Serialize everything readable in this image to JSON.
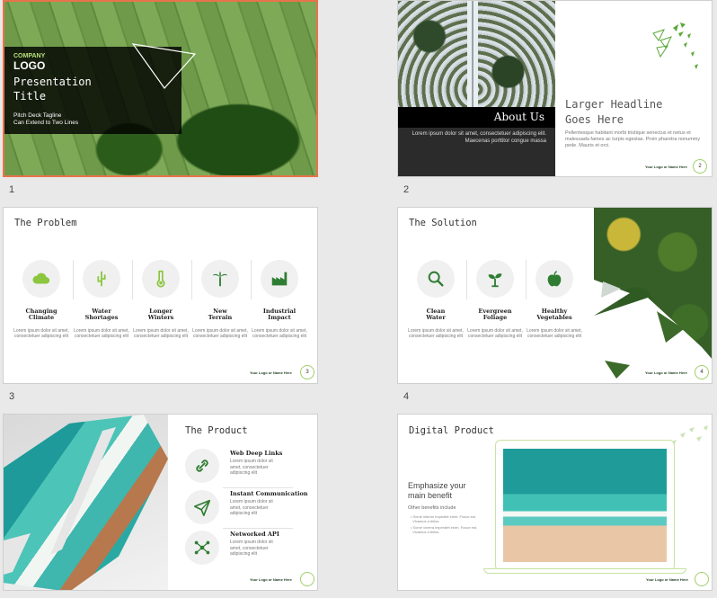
{
  "slides": [
    {
      "number": "1",
      "company": "COMPANY",
      "logo": "LOGO",
      "title_line1": "Presentation",
      "title_line2": "Title",
      "tagline_line1": "Pitch Deck Tagline",
      "tagline_line2": "Can Extend to Two Lines"
    },
    {
      "number": "2",
      "about": "About Us",
      "about_body": "Lorem ipsum dolor sit amet, consectetuer adipiscing elit. Maecenas porttitor congue massa",
      "headline_line1": "Larger Headline",
      "headline_line2": "Goes Here",
      "body": "Pellentesque habitant morbi tristique senectus et netus et malesuada fames ac turpis egestas. Proin pharetra nonummy pede. Mauris et orci.",
      "footer": "Your Logo or Name Here",
      "page": "2"
    },
    {
      "number": "3",
      "title": "The Problem",
      "items": [
        {
          "label1": "Changing",
          "label2": "Climate",
          "icon": "cloud-icon"
        },
        {
          "label1": "Water",
          "label2": "Shortages",
          "icon": "cactus-icon"
        },
        {
          "label1": "Longer",
          "label2": "Winters",
          "icon": "thermometer-icon"
        },
        {
          "label1": "New",
          "label2": "Terrain",
          "icon": "palm-tree-icon"
        },
        {
          "label1": "Industrial",
          "label2": "Impact",
          "icon": "factory-icon"
        }
      ],
      "item_body": "Lorem ipsum dolor sit amet, consectetuer adipiscing elit",
      "footer": "Your Logo or Name Here",
      "page": "3"
    },
    {
      "number": "4",
      "title": "The Solution",
      "items": [
        {
          "label1": "Clean",
          "label2": "Water",
          "icon": "magnifier-icon"
        },
        {
          "label1": "Evergreen",
          "label2": "Foliage",
          "icon": "sprout-icon"
        },
        {
          "label1": "Healthy",
          "label2": "Vegetables",
          "icon": "apple-icon"
        }
      ],
      "item_body": "Lorem ipsum dolor sit amet, consectetuer adipiscing elit",
      "footer": "Your Logo or Name Here",
      "page": "4"
    },
    {
      "title": "The Product",
      "items": [
        {
          "label": "Web Deep Links",
          "icon": "link-icon"
        },
        {
          "label": "Instant Communication",
          "icon": "paper-plane-icon"
        },
        {
          "label": "Networked API",
          "icon": "network-icon"
        }
      ],
      "item_body_line1": "Lorem ipsum dolor sit",
      "item_body_line2": "amet, consectetuer",
      "item_body_line3": "adipiscing elit",
      "footer": "Your Logo or Name Here"
    },
    {
      "title": "Digital Product",
      "headline_line1": "Emphasize your",
      "headline_line2": "main benefit",
      "sub": "Other benefits include",
      "bullet1_line1": "Some interior impediet enim. Fusce est.",
      "bullet1_line2": "Vivamus a tellus.",
      "bullet2_line1": "Some viverra imperdiet enim. Fusce est.",
      "bullet2_line2": "Vivamus a tellus.",
      "footer": "Your Logo or Name Here"
    }
  ],
  "colors": {
    "accent_green": "#2e7d32",
    "light_green": "#9fcf6a",
    "selected_border": "#e8734a"
  }
}
